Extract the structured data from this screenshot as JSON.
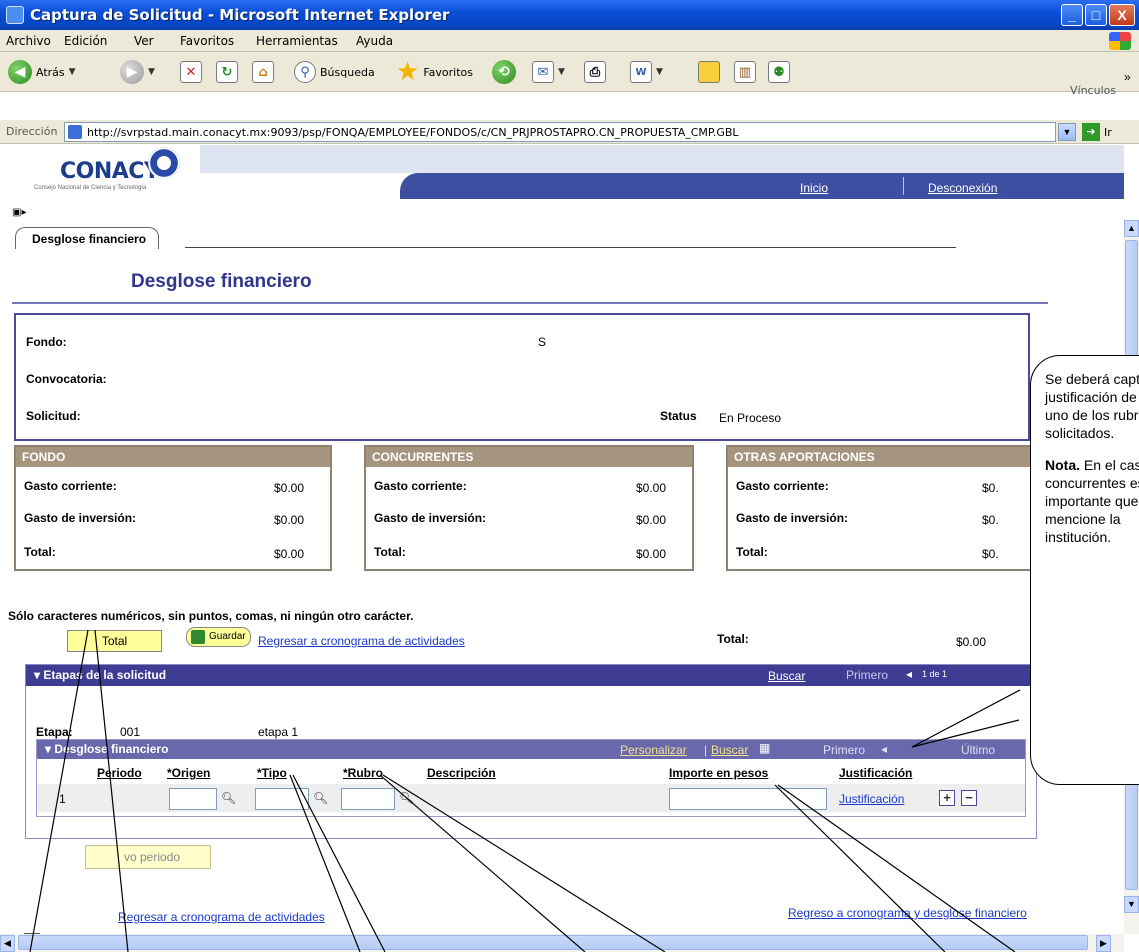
{
  "window": {
    "title": "Captura de Solicitud - Microsoft Internet Explorer",
    "min_label": "_",
    "max_label": "□",
    "close_label": "X"
  },
  "menu": {
    "archivo": "Archivo",
    "edicion": "Edición",
    "ver": "Ver",
    "favoritos": "Favoritos",
    "herramientas": "Herramientas",
    "ayuda": "Ayuda"
  },
  "toolbar": {
    "back_label": "Atrás",
    "search_label": "Búsqueda",
    "favorites_label": "Favoritos",
    "links_label": "Vínculos",
    "more_label": "»"
  },
  "address": {
    "label": "Dirección",
    "url": "http://svrpstad.main.conacyt.mx:9093/psp/FONQA/EMPLOYEE/FONDOS/c/CN_PRJPROSTAPRO.CN_PROPUESTA_CMP.GBL",
    "go_label": "Ir"
  },
  "header": {
    "logo": "CONACYT",
    "logo_sub": "Consejo Nacional de Ciencia y Tecnología",
    "nav_inicio": "Inicio",
    "nav_desconexion": "Desconexión"
  },
  "tab_label": "Desglose financiero",
  "page_title": "Desglose financiero",
  "info": {
    "fondo_label": "Fondo:",
    "fondo_value": "S",
    "convocatoria_label": "Convocatoria:",
    "solicitud_label": "Solicitud:",
    "status_label": "Status",
    "status_value": "En Proceso"
  },
  "panels": [
    {
      "title": "FONDO",
      "gasto_corriente": "Gasto corriente:",
      "gc_value": "$0.00",
      "gasto_inversion": "Gasto de inversión:",
      "gi_value": "$0.00",
      "total": "Total:",
      "total_value": "$0.00"
    },
    {
      "title": "CONCURRENTES",
      "gasto_corriente": "Gasto corriente:",
      "gc_value": "$0.00",
      "gasto_inversion": "Gasto de inversión:",
      "gi_value": "$0.00",
      "total": "Total:",
      "total_value": "$0.00"
    },
    {
      "title": "OTRAS APORTACIONES",
      "gasto_corriente": "Gasto corriente:",
      "gc_value": "$0.",
      "gasto_inversion": "Gasto de inversión:",
      "gi_value": "$0.",
      "total": "Total:",
      "total_value": "$0."
    }
  ],
  "note": "Sólo caracteres numéricos, sin puntos, comas, ni ningún otro carácter.",
  "buttons": {
    "total": "Total",
    "guardar": "Guardar",
    "regresar_cronograma": "Regresar a cronograma de actividades",
    "nuevo_periodo": "vo periodo"
  },
  "totals": {
    "label": "Total:",
    "value": "$0.00"
  },
  "etapas": {
    "title": "Etapas de la solicitud",
    "buscar": "Buscar",
    "primero": "Primero",
    "range": "1 de 1",
    "etapa_label": "Etapa:",
    "etapa_value": "001",
    "etapa_name": "etapa 1"
  },
  "desglose": {
    "title": "Desglose financiero",
    "personalizar": "Personalizar",
    "buscar": "Buscar",
    "primero": "Primero",
    "ultimo": "Último",
    "col_periodo": "Periodo",
    "col_origen": "*Origen",
    "col_tipo": "*Tipo",
    "col_rubro": "*Rubro",
    "col_descripcion": "Descripción",
    "col_importe": "Importe en pesos",
    "col_justificacion": "Justificación",
    "row_num": "1",
    "justificacion_link": "Justificación"
  },
  "footer_links": {
    "cronograma": "Regresar a cronograma de actividades",
    "regreso": "Regreso a cronograma y desglose financiero"
  },
  "callout": {
    "l1": "Se deberá capturar la",
    "l2": "justificación de cada",
    "l3": "uno de los rubros",
    "l4": "solicitados.",
    "nota_bold": "Nota.",
    "nota_rest": " En el caso de",
    "l6": "concurrentes es",
    "l7": "importante que se",
    "l8": "mencione la",
    "l9": "institución."
  }
}
